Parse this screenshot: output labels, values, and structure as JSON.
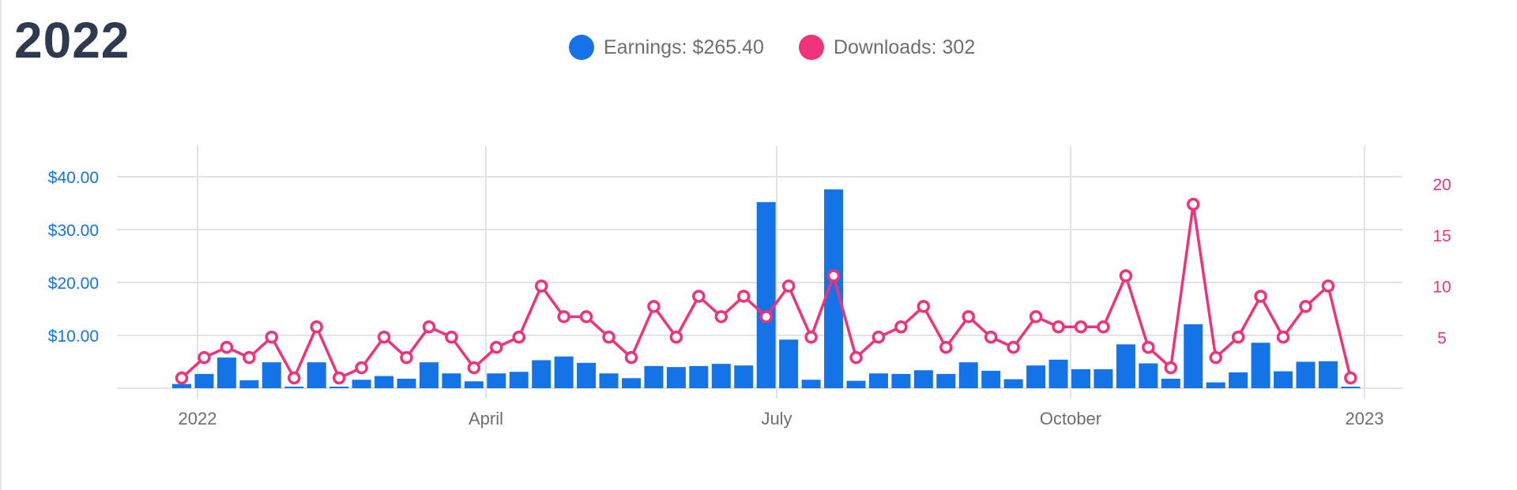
{
  "title": "2022",
  "legend": {
    "earnings": "Earnings: $265.40",
    "downloads": "Downloads: 302"
  },
  "colors": {
    "earnings": "#1473e6",
    "downloads": "#f0327a",
    "title": "#2d3a50",
    "grid": "#e3e3e3"
  },
  "chart_data": {
    "type": "bar",
    "combo": "bar + line with dual y-axes",
    "x_ticks": [
      "2022",
      "April",
      "July",
      "October",
      "2023"
    ],
    "y_left": {
      "ticks": [
        "$10.00",
        "$20.00",
        "$30.00",
        "$40.00"
      ],
      "tick_values": [
        10,
        20,
        30,
        40
      ],
      "range": [
        0,
        40
      ]
    },
    "y_right": {
      "ticks": [
        "5",
        "10",
        "15",
        "20"
      ],
      "tick_values": [
        5,
        10,
        15,
        20
      ],
      "range": [
        0,
        20
      ]
    },
    "grid": true,
    "legend_position": "top-center",
    "series": [
      {
        "name": "Earnings",
        "type": "bar",
        "axis": "left",
        "values": [
          0.8,
          2.7,
          5.8,
          1.5,
          4.9,
          0.3,
          4.9,
          0.3,
          1.6,
          2.3,
          1.8,
          4.9,
          2.8,
          1.3,
          2.8,
          3.1,
          5.3,
          6.0,
          4.8,
          2.8,
          1.9,
          4.2,
          4.0,
          4.2,
          4.6,
          4.3,
          35.2,
          9.2,
          1.6,
          37.6,
          1.4,
          2.8,
          2.7,
          3.4,
          2.7,
          4.9,
          3.3,
          1.7,
          4.3,
          5.4,
          3.6,
          3.6,
          8.3,
          4.7,
          1.8,
          12.1,
          1.1,
          3.0,
          8.6,
          3.2,
          5.0,
          5.1,
          0.3
        ]
      },
      {
        "name": "Downloads",
        "type": "line",
        "axis": "right",
        "values": [
          1,
          3,
          4,
          3,
          5,
          1,
          6,
          1,
          2,
          5,
          3,
          6,
          5,
          2,
          4,
          5,
          10,
          7,
          7,
          5,
          3,
          8,
          5,
          9,
          7,
          9,
          7,
          10,
          5,
          11,
          3,
          5,
          6,
          8,
          4,
          7,
          5,
          4,
          7,
          6,
          6,
          6,
          11,
          4,
          2,
          18,
          3,
          5,
          9,
          5,
          8,
          10,
          1
        ]
      }
    ]
  }
}
